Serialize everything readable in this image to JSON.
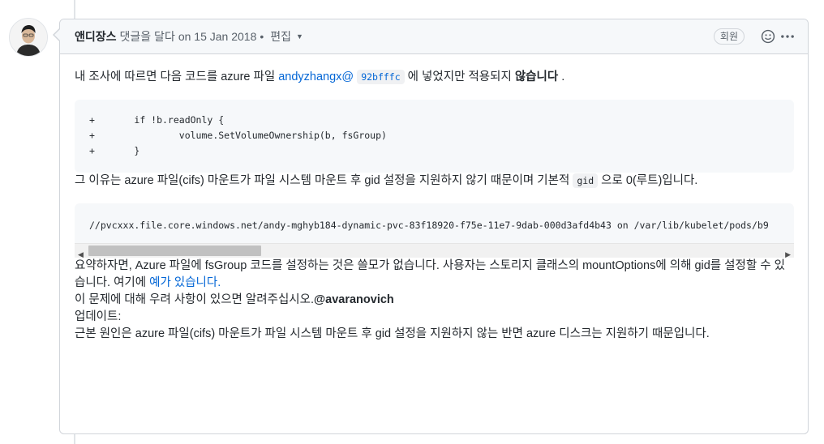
{
  "comment": {
    "author": "앤디장스",
    "action": "댓글을 달다",
    "date": "on 15 Jan 2018",
    "bullet": "•",
    "edited": "편집",
    "member_badge": "회원",
    "more_icon_label": "···"
  },
  "body": {
    "p1_prefix": "내 조사에 따르면 다음 코드를 azure 파일 ",
    "p1_link": "andyzhangx@",
    "p1_commit": "92bfffc",
    "p1_mid": " 에 넣었지만 적용되지 ",
    "p1_strong": "않습니다",
    "p1_suffix": " .",
    "code1": "+\tif !b.readOnly {\n+\t\tvolume.SetVolumeOwnership(b, fsGroup)\n+\t}",
    "p2_prefix": "그 이유는 azure 파일(cifs) 마운트가 파일 시스템 마운트 후 gid 설정을 지원하지 않기 때문이며 기본적 ",
    "p2_code": "gid",
    "p2_suffix": " 으로 0(루트)입니다.",
    "code2": "//pvcxxx.file.core.windows.net/andy-mghyb184-dynamic-pvc-83f18920-f75e-11e7-9dab-000d3afd4b43 on /var/lib/kubelet/pods/b9",
    "p3_text": "요약하자면, Azure 파일에 fsGroup 코드를 설정하는 것은 쓸모가 없습니다. 사용자는 스토리지 클래스의 mountOptions에 의해 gid를 설정할 수 있습니다. 여기에 ",
    "p3_link": "예가 있습니다.",
    "p4_text": "이 문제에 대해 우려 사항이 있으면 알려주십시오.",
    "p4_mention": "@avaranovich",
    "p5_title": "업데이트:",
    "p5_text": "근본 원인은 azure 파일(cifs) 마운트가 파일 시스템 마운트 후 gid 설정을 지원하지 않는 반면 azure 디스크는 지원하기 때문입니다."
  },
  "scrollbar": {
    "left_arrow": "◀",
    "right_arrow": "▶"
  }
}
